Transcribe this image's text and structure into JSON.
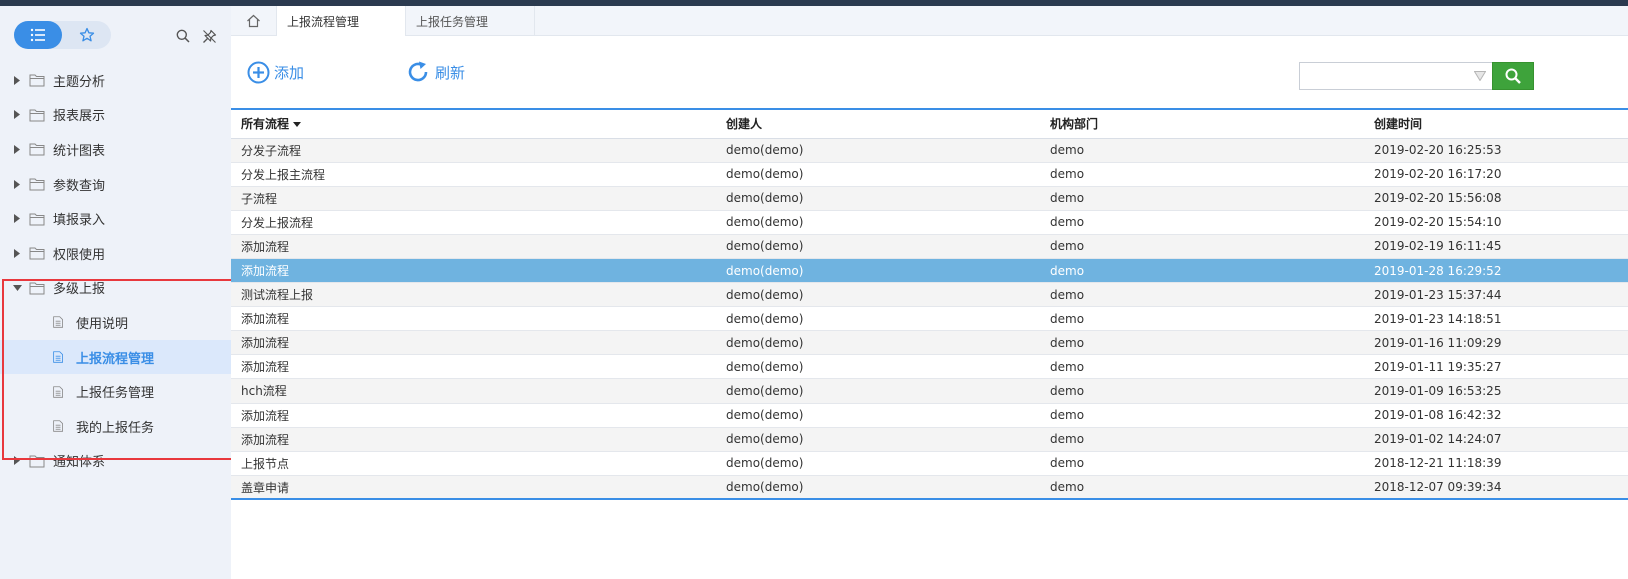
{
  "colors": {
    "accent": "#3a8ee6",
    "search_button": "#3ea33b",
    "selected_row": "#6fb3e0",
    "highlight_box": "#e8383d"
  },
  "sidebar": {
    "view_toggle": {
      "list_icon": "list-icon",
      "favorites_icon": "star-icon"
    },
    "tools": {
      "search_icon": "search-icon",
      "pin_icon": "pin-icon"
    },
    "items": [
      {
        "label": "主题分析",
        "type": "folder",
        "expanded": false
      },
      {
        "label": "报表展示",
        "type": "folder",
        "expanded": false
      },
      {
        "label": "统计图表",
        "type": "folder",
        "expanded": false
      },
      {
        "label": "参数查询",
        "type": "folder",
        "expanded": false
      },
      {
        "label": "填报录入",
        "type": "folder",
        "expanded": false
      },
      {
        "label": "权限使用",
        "type": "folder",
        "expanded": false
      },
      {
        "label": "多级上报",
        "type": "folder",
        "expanded": true,
        "children": [
          {
            "label": "使用说明",
            "active": false
          },
          {
            "label": "上报流程管理",
            "active": true
          },
          {
            "label": "上报任务管理",
            "active": false
          },
          {
            "label": "我的上报任务",
            "active": false
          }
        ]
      },
      {
        "label": "通知体系",
        "type": "folder",
        "expanded": false
      }
    ]
  },
  "tabs": [
    {
      "label": "上报流程管理",
      "active": true
    },
    {
      "label": "上报任务管理",
      "active": false
    }
  ],
  "toolbar": {
    "add_label": "添加",
    "refresh_label": "刷新",
    "search_placeholder": ""
  },
  "table": {
    "columns": [
      "所有流程",
      "创建人",
      "机构部门",
      "创建时间"
    ],
    "selected_index": 5,
    "rows": [
      [
        "分发子流程",
        "demo(demo)",
        "demo",
        "2019-02-20 16:25:53"
      ],
      [
        "分发上报主流程",
        "demo(demo)",
        "demo",
        "2019-02-20 16:17:20"
      ],
      [
        "子流程",
        "demo(demo)",
        "demo",
        "2019-02-20 15:56:08"
      ],
      [
        "分发上报流程",
        "demo(demo)",
        "demo",
        "2019-02-20 15:54:10"
      ],
      [
        "添加流程",
        "demo(demo)",
        "demo",
        "2019-02-19 16:11:45"
      ],
      [
        "添加流程",
        "demo(demo)",
        "demo",
        "2019-01-28 16:29:52"
      ],
      [
        "测试流程上报",
        "demo(demo)",
        "demo",
        "2019-01-23 15:37:44"
      ],
      [
        "添加流程",
        "demo(demo)",
        "demo",
        "2019-01-23 14:18:51"
      ],
      [
        "添加流程",
        "demo(demo)",
        "demo",
        "2019-01-16 11:09:29"
      ],
      [
        "添加流程",
        "demo(demo)",
        "demo",
        "2019-01-11 19:35:27"
      ],
      [
        "hch流程",
        "demo(demo)",
        "demo",
        "2019-01-09 16:53:25"
      ],
      [
        "添加流程",
        "demo(demo)",
        "demo",
        "2019-01-08 16:42:32"
      ],
      [
        "添加流程",
        "demo(demo)",
        "demo",
        "2019-01-02 14:24:07"
      ],
      [
        "上报节点",
        "demo(demo)",
        "demo",
        "2018-12-21 11:18:39"
      ],
      [
        "盖章申请",
        "demo(demo)",
        "demo",
        "2018-12-07 09:39:34"
      ]
    ]
  }
}
